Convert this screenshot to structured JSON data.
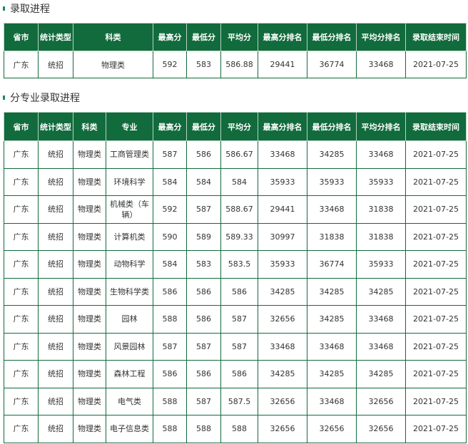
{
  "section1": {
    "title": "录取进程",
    "headers": [
      "省市",
      "统计类型",
      "科类",
      "最高分",
      "最低分",
      "平均分",
      "最高分排名",
      "最低分排名",
      "平均分排名",
      "录取结束时间"
    ],
    "rows": [
      [
        "广东",
        "统招",
        "物理类",
        "592",
        "583",
        "586.88",
        "29441",
        "36774",
        "33468",
        "2021-07-25"
      ]
    ]
  },
  "section2": {
    "title": "分专业录取进程",
    "headers": [
      "省市",
      "统计类型",
      "科类",
      "专业",
      "最高分",
      "最低分",
      "平均分",
      "最高分排名",
      "最低分排名",
      "平均分排名",
      "录取结束时间"
    ],
    "rows": [
      [
        "广东",
        "统招",
        "物理类",
        "工商管理类",
        "587",
        "586",
        "586.67",
        "33468",
        "34285",
        "33468",
        "2021-07-25"
      ],
      [
        "广东",
        "统招",
        "物理类",
        "环境科学",
        "584",
        "584",
        "584",
        "35933",
        "35933",
        "35933",
        "2021-07-25"
      ],
      [
        "广东",
        "统招",
        "物理类",
        "机械类（车辆）",
        "592",
        "587",
        "588.67",
        "29441",
        "33468",
        "31838",
        "2021-07-25"
      ],
      [
        "广东",
        "统招",
        "物理类",
        "计算机类",
        "590",
        "589",
        "589.33",
        "30997",
        "31838",
        "31838",
        "2021-07-25"
      ],
      [
        "广东",
        "统招",
        "物理类",
        "动物科学",
        "584",
        "583",
        "583.5",
        "35933",
        "36774",
        "35933",
        "2021-07-25"
      ],
      [
        "广东",
        "统招",
        "物理类",
        "生物科学类",
        "586",
        "586",
        "586",
        "34285",
        "34285",
        "34285",
        "2021-07-25"
      ],
      [
        "广东",
        "统招",
        "物理类",
        "园林",
        "588",
        "586",
        "587",
        "32656",
        "34285",
        "33468",
        "2021-07-25"
      ],
      [
        "广东",
        "统招",
        "物理类",
        "风景园林",
        "587",
        "587",
        "587",
        "33468",
        "33468",
        "33468",
        "2021-07-25"
      ],
      [
        "广东",
        "统招",
        "物理类",
        "森林工程",
        "586",
        "586",
        "586",
        "34285",
        "34285",
        "34285",
        "2021-07-25"
      ],
      [
        "广东",
        "统招",
        "物理类",
        "电气类",
        "588",
        "587",
        "587.5",
        "32656",
        "33468",
        "32656",
        "2021-07-25"
      ],
      [
        "广东",
        "统招",
        "物理类",
        "电子信息类",
        "588",
        "588",
        "588",
        "32656",
        "32656",
        "32656",
        "2021-07-25"
      ]
    ]
  },
  "colors": {
    "header_bg": "#116b3c",
    "header_text": "#ffffff",
    "border": "#116b3c",
    "marker": "#1f8a55"
  }
}
